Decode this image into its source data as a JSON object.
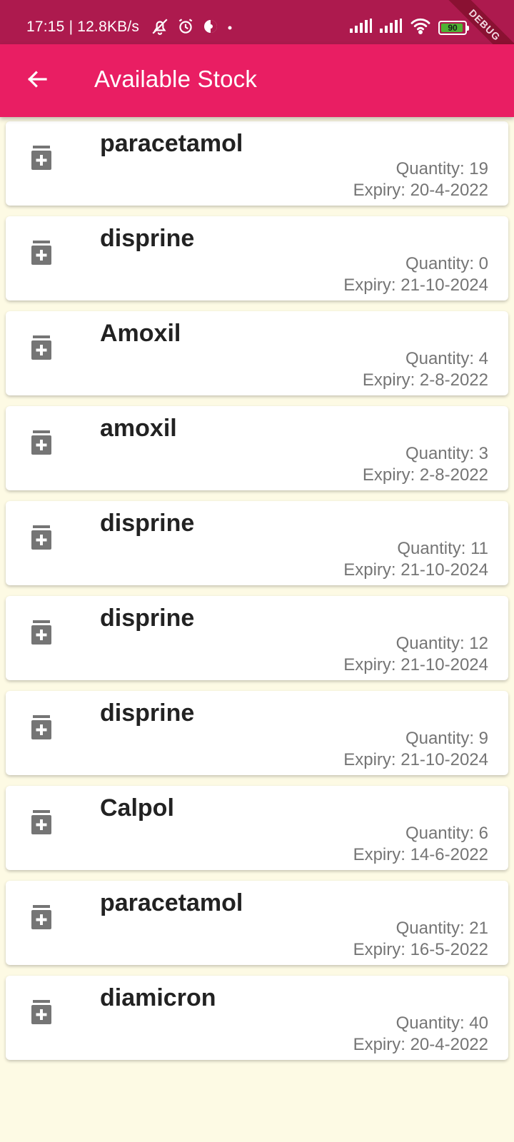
{
  "status_bar": {
    "time_speed": "17:15 | 12.8KB/s",
    "battery_level": "90",
    "debug_label": "DEBUG"
  },
  "app_bar": {
    "title": "Available Stock"
  },
  "icons": {
    "back": "arrow-back-icon",
    "item": "medicine-box-icon"
  },
  "colors": {
    "status_bar": "#ad1a4e",
    "app_bar": "#e91e63",
    "background": "#fdfae4",
    "battery": "#4fb233"
  },
  "stock_items": [
    {
      "name": "paracetamol",
      "quantity": "Quantity: 19",
      "expiry": "Expiry: 20-4-2022"
    },
    {
      "name": "disprine",
      "quantity": "Quantity: 0",
      "expiry": "Expiry: 21-10-2024"
    },
    {
      "name": "Amoxil",
      "quantity": "Quantity: 4",
      "expiry": "Expiry: 2-8-2022"
    },
    {
      "name": "amoxil",
      "quantity": "Quantity: 3",
      "expiry": "Expiry: 2-8-2022"
    },
    {
      "name": "disprine",
      "quantity": "Quantity: 11",
      "expiry": "Expiry: 21-10-2024"
    },
    {
      "name": "disprine",
      "quantity": "Quantity: 12",
      "expiry": "Expiry: 21-10-2024"
    },
    {
      "name": "disprine",
      "quantity": "Quantity: 9",
      "expiry": "Expiry: 21-10-2024"
    },
    {
      "name": "Calpol",
      "quantity": "Quantity: 6",
      "expiry": "Expiry: 14-6-2022"
    },
    {
      "name": "paracetamol",
      "quantity": "Quantity: 21",
      "expiry": "Expiry: 16-5-2022"
    },
    {
      "name": "diamicron",
      "quantity": "Quantity: 40",
      "expiry": "Expiry: 20-4-2022"
    }
  ]
}
